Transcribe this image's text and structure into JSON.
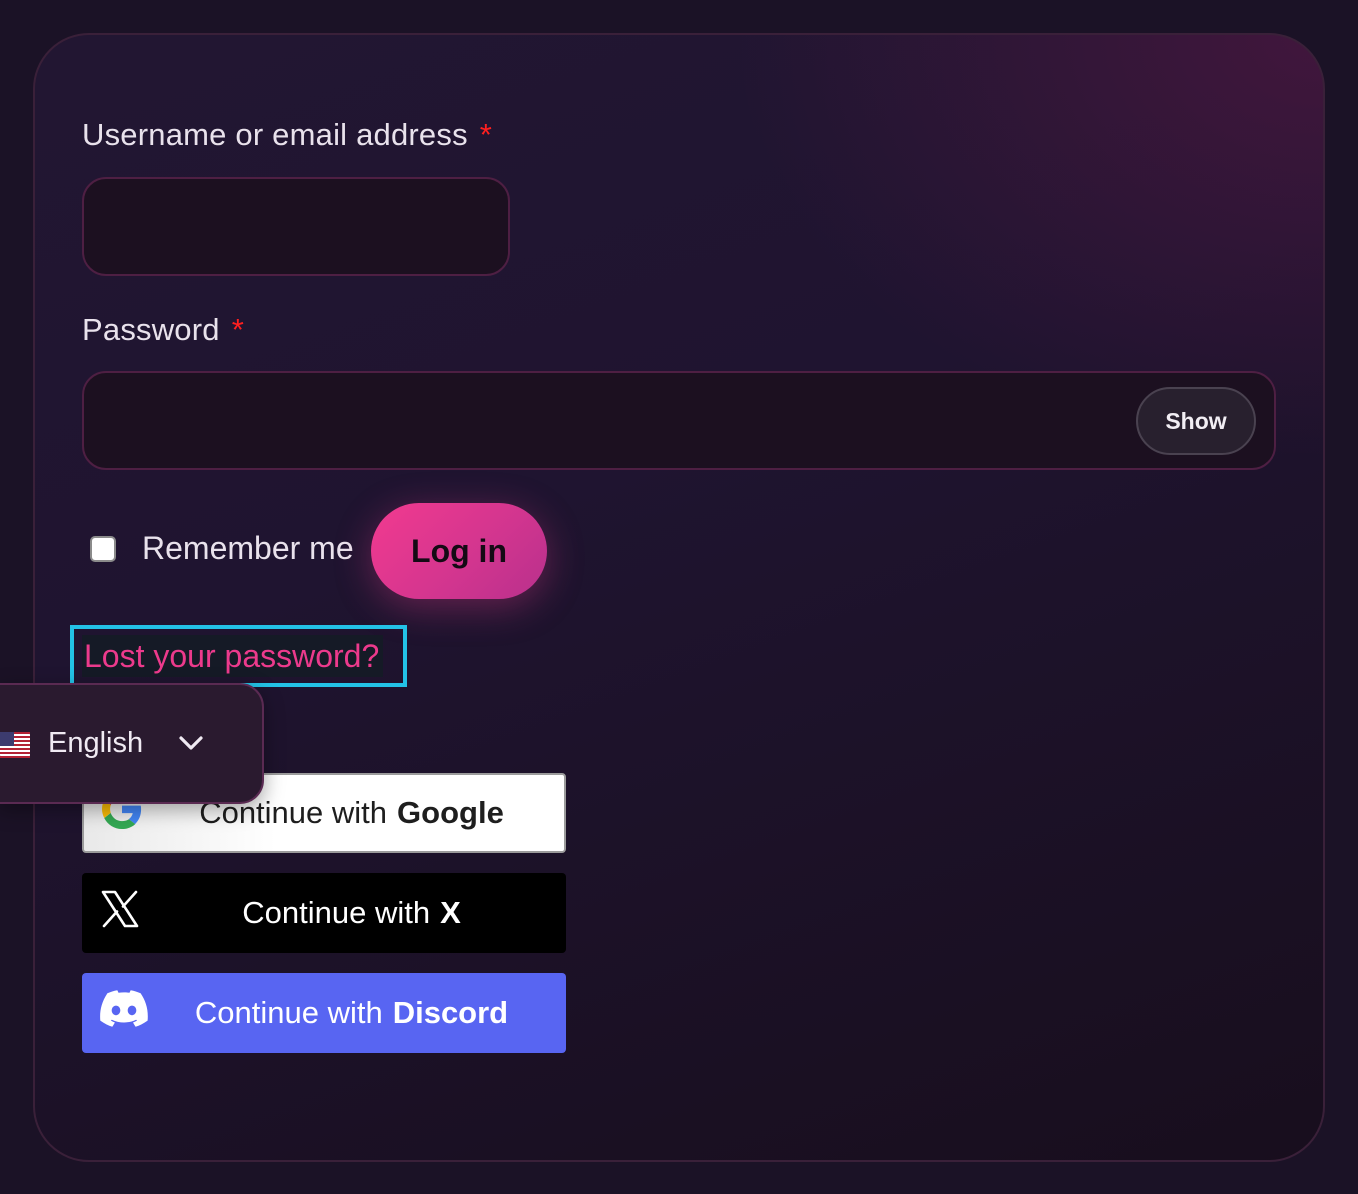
{
  "form": {
    "username_label": "Username or email address",
    "username_required": "*",
    "username_value": "",
    "password_label": "Password",
    "password_required": "*",
    "password_value": "",
    "show_button": "Show",
    "remember_label": "Remember me",
    "remember_checked": false,
    "login_button": "Log in",
    "lost_password_link": "Lost your password?"
  },
  "language": {
    "selected": "English",
    "flag_icon": "us-flag-icon",
    "chevron_icon": "chevron-down-icon"
  },
  "social": {
    "google": {
      "prefix": "Continue with",
      "provider": "Google",
      "icon": "google-icon"
    },
    "x": {
      "prefix": "Continue with",
      "provider": "X",
      "icon": "x-logo-icon"
    },
    "discord": {
      "prefix": "Continue with",
      "provider": "Discord",
      "icon": "discord-icon"
    }
  },
  "colors": {
    "accent": "#ec3a8c",
    "required": "#ff1f1f",
    "discord": "#5865f2",
    "focus_outline": "#23c2e6"
  }
}
